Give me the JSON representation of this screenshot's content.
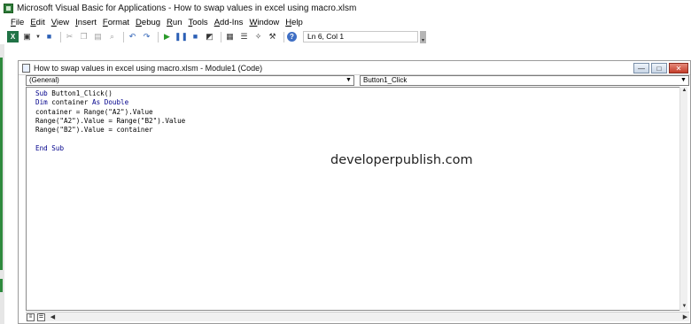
{
  "app": {
    "title": "Microsoft Visual Basic for Applications - How to swap values in excel using macro.xlsm"
  },
  "menu": [
    {
      "label": "File",
      "u": "F",
      "rest": "ile"
    },
    {
      "label": "Edit",
      "u": "E",
      "rest": "dit"
    },
    {
      "label": "View",
      "u": "V",
      "rest": "iew"
    },
    {
      "label": "Insert",
      "u": "I",
      "rest": "nsert"
    },
    {
      "label": "Format",
      "u": "F",
      "rest": "ormat"
    },
    {
      "label": "Debug",
      "u": "D",
      "rest": "ebug"
    },
    {
      "label": "Run",
      "u": "R",
      "rest": "un"
    },
    {
      "label": "Tools",
      "u": "T",
      "rest": "ools"
    },
    {
      "label": "Add-Ins",
      "u": "A",
      "rest": "dd-Ins"
    },
    {
      "label": "Window",
      "u": "W",
      "rest": "indow"
    },
    {
      "label": "Help",
      "u": "H",
      "rest": "elp"
    }
  ],
  "toolbar": {
    "cursor_position": "Ln 6, Col 1",
    "icons": [
      "view-excel-icon",
      "insert-module-icon",
      "save-icon",
      "cut-icon",
      "copy-icon",
      "paste-icon",
      "find-icon",
      "undo-icon",
      "redo-icon",
      "run-icon",
      "break-icon",
      "reset-icon",
      "design-mode-icon",
      "project-explorer-icon",
      "properties-icon",
      "object-browser-icon",
      "toolbox-icon",
      "help-icon"
    ]
  },
  "code_window": {
    "title": "How to swap values in excel using macro.xlsm - Module1 (Code)",
    "object_combo": "(General)",
    "procedure_combo": "Button1_Click",
    "code_lines": [
      "Sub Button1_Click()",
      "Dim container As Double",
      "container = Range(\"A2\").Value",
      "Range(\"A2\").Value = Range(\"B2\").Value",
      "Range(\"B2\").Value = container",
      "",
      "End Sub"
    ]
  },
  "watermark": "developerpublish.com",
  "colors": {
    "excel_green": "#217346",
    "keyword_blue": "#00008b",
    "close_red": "#c43c2a"
  }
}
